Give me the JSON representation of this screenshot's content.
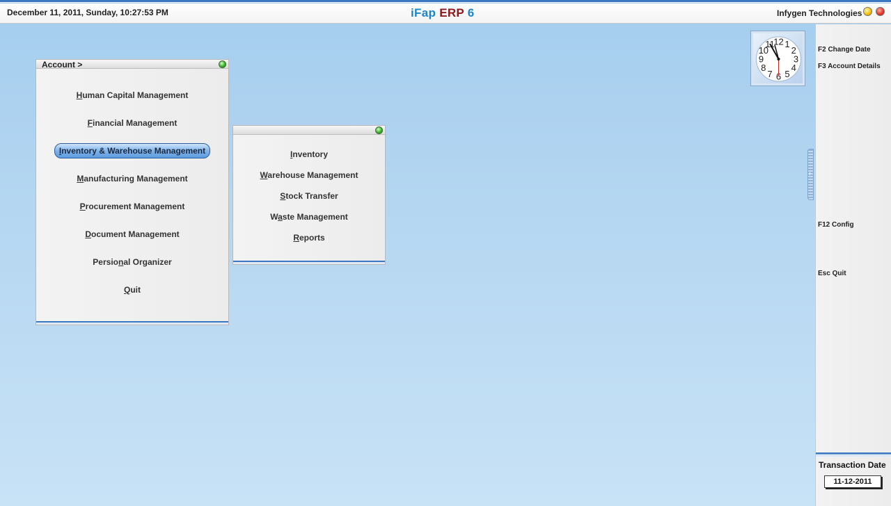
{
  "topbar": {
    "datetime": "December  11, 2011, Sunday, 10:27:53 PM",
    "app_title_part1": "iFap",
    "app_title_part2": "ERP",
    "app_title_part3": "6",
    "company": "Infygen Technologies"
  },
  "clock": {
    "numerals": [
      "12",
      "1",
      "2",
      "3",
      "4",
      "5",
      "6",
      "7",
      "8",
      "9",
      "10",
      "11"
    ]
  },
  "main_menu": {
    "title": "Account >",
    "items": [
      {
        "hot": "H",
        "rest": "uman Capital Management",
        "pre": ""
      },
      {
        "hot": "F",
        "rest": "inancial Management",
        "pre": ""
      },
      {
        "hot": "I",
        "rest": "nventory & Warehouse Management",
        "pre": "",
        "selected": true
      },
      {
        "hot": "M",
        "rest": "anufacturing Management",
        "pre": ""
      },
      {
        "hot": "P",
        "rest": "rocurement Management",
        "pre": ""
      },
      {
        "hot": "D",
        "rest": "ocument Management",
        "pre": ""
      },
      {
        "hot": "n",
        "rest": "al Organizer",
        "pre": "Persio"
      },
      {
        "hot": "Q",
        "rest": "uit",
        "pre": ""
      }
    ]
  },
  "sub_menu": {
    "title": "",
    "items": [
      {
        "hot": "I",
        "rest": "nventory",
        "pre": ""
      },
      {
        "hot": "W",
        "rest": "arehouse Management",
        "pre": ""
      },
      {
        "hot": "S",
        "rest": "tock Transfer",
        "pre": ""
      },
      {
        "hot": "a",
        "rest": "ste Management",
        "pre": "W"
      },
      {
        "hot": "R",
        "rest": "eports",
        "pre": ""
      }
    ]
  },
  "right_panel": {
    "f2": "F2 Change Date",
    "f3": "F3 Account Details",
    "f12": "F12 Config",
    "esc": "Esc Quit",
    "transaction_label": "Transaction Date",
    "transaction_date": "11-12-2011"
  },
  "colors": {
    "accent_blue": "#3a78c2",
    "title_blue": "#1e86c8",
    "title_red": "#8a1a1a",
    "background": "#b4d6f1"
  }
}
